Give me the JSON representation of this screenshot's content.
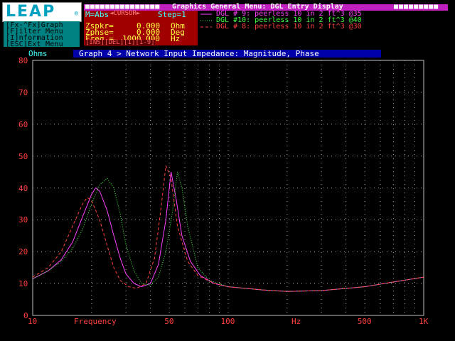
{
  "logo_text": "LEAP",
  "logo_reg": "®",
  "help_menu": [
    "[Fx-^Fx]Graph",
    "[F]ilter Menu",
    "[I]nformation",
    "[ESC]Ext Menu"
  ],
  "general_menu_title": "Graphics General Menu: DGL Entry Display",
  "mode_line": {
    "mode": "M=Abs",
    "cursor": "◄CURSOR►",
    "step": "Step=1"
  },
  "params": [
    {
      "label": "Zspkr=",
      "value": "0.000",
      "unit": "Ohm"
    },
    {
      "label": "Zphse=",
      "value": "0.000",
      "unit": "Deg"
    },
    {
      "label": "Freq =",
      "value": "1000.000",
      "unit": "Hz"
    }
  ],
  "ins_bar": "[INS][DEL][1][1-9]",
  "legend": [
    {
      "style": "solid",
      "label": "DGL # 9: peerless 10 in 2 ft^3 @35",
      "color": "#ff40ff"
    },
    {
      "style": "dotted",
      "label": "DGL #10: peerless 10 in 2 ft^3 @40",
      "color": "#40ff40"
    },
    {
      "style": "dashed",
      "label": "DGL # 8: peerless 10 in 2 ft^3 @30",
      "color": "#ff4040"
    }
  ],
  "y_unit_label": "Ohms",
  "graph_title": "Graph 4 > Network Input Impedance: Magnitude, Phase",
  "x_axis_label_left": "Frequency",
  "x_axis_label_right": "Hz",
  "chart_data": {
    "type": "line",
    "title": "Graph 4 > Network Input Impedance: Magnitude, Phase",
    "ylabel": "Ohms",
    "xlabel": "Frequency Hz",
    "x_scale": "log",
    "xlim": [
      10,
      1000
    ],
    "ylim": [
      0,
      80
    ],
    "y_ticks": [
      0,
      10,
      20,
      30,
      40,
      50,
      60,
      70,
      80
    ],
    "x_tick_labels": [
      {
        "value": 10,
        "label": "10"
      },
      {
        "value": 50,
        "label": "50"
      },
      {
        "value": 100,
        "label": "100"
      },
      {
        "value": 500,
        "label": "500"
      },
      {
        "value": 1000,
        "label": "1K"
      }
    ],
    "grid": true,
    "series": [
      {
        "name": "DGL # 9: peerless 10 in 2 ft^3 @35",
        "color": "#ff40ff",
        "style": "solid",
        "points": [
          [
            10,
            11.5
          ],
          [
            12,
            14
          ],
          [
            14,
            17.5
          ],
          [
            16,
            23
          ],
          [
            18,
            31
          ],
          [
            20,
            38
          ],
          [
            21,
            40
          ],
          [
            22,
            39
          ],
          [
            24,
            33
          ],
          [
            26,
            25
          ],
          [
            28,
            18
          ],
          [
            30,
            13
          ],
          [
            33,
            10
          ],
          [
            36,
            9
          ],
          [
            40,
            10
          ],
          [
            44,
            16
          ],
          [
            48,
            30
          ],
          [
            51,
            45
          ],
          [
            54,
            37
          ],
          [
            58,
            25
          ],
          [
            64,
            17
          ],
          [
            72,
            12.5
          ],
          [
            85,
            10
          ],
          [
            100,
            9
          ],
          [
            150,
            8
          ],
          [
            200,
            7.5
          ],
          [
            300,
            7.8
          ],
          [
            500,
            9
          ],
          [
            700,
            10.5
          ],
          [
            1000,
            12
          ]
        ]
      },
      {
        "name": "DGL #10: peerless 10 in 2 ft^3 @40",
        "color": "#40ff40",
        "style": "dotted",
        "points": [
          [
            10,
            11.5
          ],
          [
            12,
            14
          ],
          [
            14,
            17
          ],
          [
            16,
            21
          ],
          [
            18,
            27
          ],
          [
            20,
            35
          ],
          [
            22,
            41
          ],
          [
            24,
            43
          ],
          [
            26,
            40
          ],
          [
            28,
            32
          ],
          [
            30,
            22
          ],
          [
            33,
            14
          ],
          [
            36,
            10
          ],
          [
            40,
            9.5
          ],
          [
            44,
            12
          ],
          [
            48,
            20
          ],
          [
            52,
            33
          ],
          [
            55,
            45
          ],
          [
            58,
            40
          ],
          [
            62,
            28
          ],
          [
            70,
            15
          ],
          [
            80,
            11
          ],
          [
            100,
            9
          ],
          [
            150,
            8
          ],
          [
            200,
            7.5
          ],
          [
            300,
            7.8
          ],
          [
            500,
            9
          ],
          [
            700,
            10.5
          ],
          [
            1000,
            12
          ]
        ]
      },
      {
        "name": "DGL # 8: peerless 10 in 2 ft^3 @30",
        "color": "#ff4040",
        "style": "dashed",
        "points": [
          [
            10,
            12
          ],
          [
            12,
            15
          ],
          [
            14,
            20
          ],
          [
            16,
            28
          ],
          [
            18,
            35
          ],
          [
            19,
            37
          ],
          [
            20,
            36
          ],
          [
            22,
            30
          ],
          [
            24,
            22
          ],
          [
            26,
            15
          ],
          [
            28,
            11
          ],
          [
            31,
            9
          ],
          [
            34,
            8.5
          ],
          [
            38,
            10
          ],
          [
            42,
            18
          ],
          [
            45,
            32
          ],
          [
            48,
            47
          ],
          [
            51,
            43
          ],
          [
            55,
            28
          ],
          [
            62,
            17
          ],
          [
            70,
            12.5
          ],
          [
            85,
            10
          ],
          [
            100,
            9
          ],
          [
            150,
            8
          ],
          [
            200,
            7.5
          ],
          [
            300,
            7.8
          ],
          [
            500,
            9
          ],
          [
            700,
            10.5
          ],
          [
            1000,
            12
          ]
        ]
      }
    ]
  }
}
